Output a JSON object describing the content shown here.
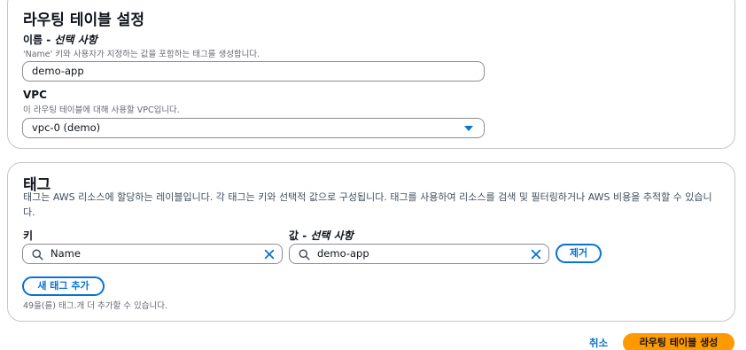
{
  "route_table_settings": {
    "title": "라우팅 테이블 설정",
    "name_label": "이름 - ",
    "name_optional": "선택 사항",
    "name_description": "'Name' 키와 사용자가 지정하는 값을 포함하는 태그를 생성합니다.",
    "name_value": "demo-app",
    "vpc_label": "VPC",
    "vpc_description": "이 라우팅 테이블에 대해 사용할 VPC입니다.",
    "vpc_value": "vpc-0                          (demo)"
  },
  "tags": {
    "title": "태그",
    "description": "태그는 AWS 리소스에 할당하는 레이블입니다. 각 태그는 키와 선택적 값으로 구성됩니다. 태그를 사용하여 리소스를 검색 및 필터링하거나 AWS 비용을 추적할 수 있습니다.",
    "key_label": "키",
    "value_label": "값 - ",
    "value_optional": "선택 사항",
    "key_value": "Name",
    "value_value": "demo-app",
    "remove_button": "제거",
    "add_button": "새 태그 추가",
    "remaining_text": "49을(를) 태그.개 더 추가할 수 있습니다."
  },
  "footer": {
    "cancel": "취소",
    "create": "라우팅 테이블 생성"
  },
  "colors": {
    "accent": "#0972d3",
    "primary_button": "#ff9900"
  }
}
